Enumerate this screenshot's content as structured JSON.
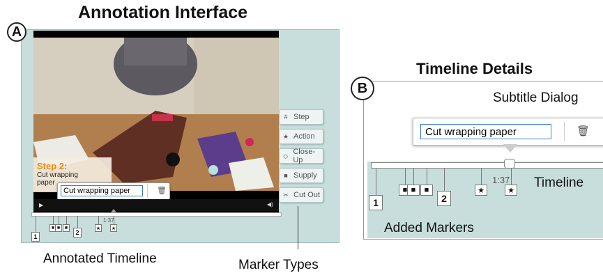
{
  "panel_a": {
    "label": "A",
    "title": "Annotation Interface",
    "step_overlay": {
      "step": "Step 2:",
      "text_line1": "Cut wrapping",
      "text_line2": "paper"
    },
    "subtitle_input_value": "Cut wrapping paper",
    "current_time": "1:37",
    "marker_types": [
      {
        "icon": "#",
        "label": "Step"
      },
      {
        "icon": "★",
        "label": "Action"
      },
      {
        "icon": "◇",
        "label": "Close-Up"
      },
      {
        "icon": "■",
        "label": "Supply"
      },
      {
        "icon": "✂",
        "label": "Cut Out"
      }
    ],
    "markers": [
      "1",
      "2"
    ],
    "caption_timeline": "Annotated Timeline",
    "caption_marker_types": "Marker Types"
  },
  "panel_b": {
    "label": "B",
    "title": "Timeline Details",
    "subtitle_dialog_label": "Subtitle Dialog",
    "subtitle_input_value": "Cut wrapping paper",
    "current_time": "1:37",
    "timeline_label": "Timeline",
    "added_markers_label": "Added Markers",
    "markers": [
      "1",
      "2"
    ]
  },
  "colors": {
    "panel_bg": "#c8dedd",
    "step_orange": "#e88a1a",
    "input_border": "#3a7bd5"
  }
}
